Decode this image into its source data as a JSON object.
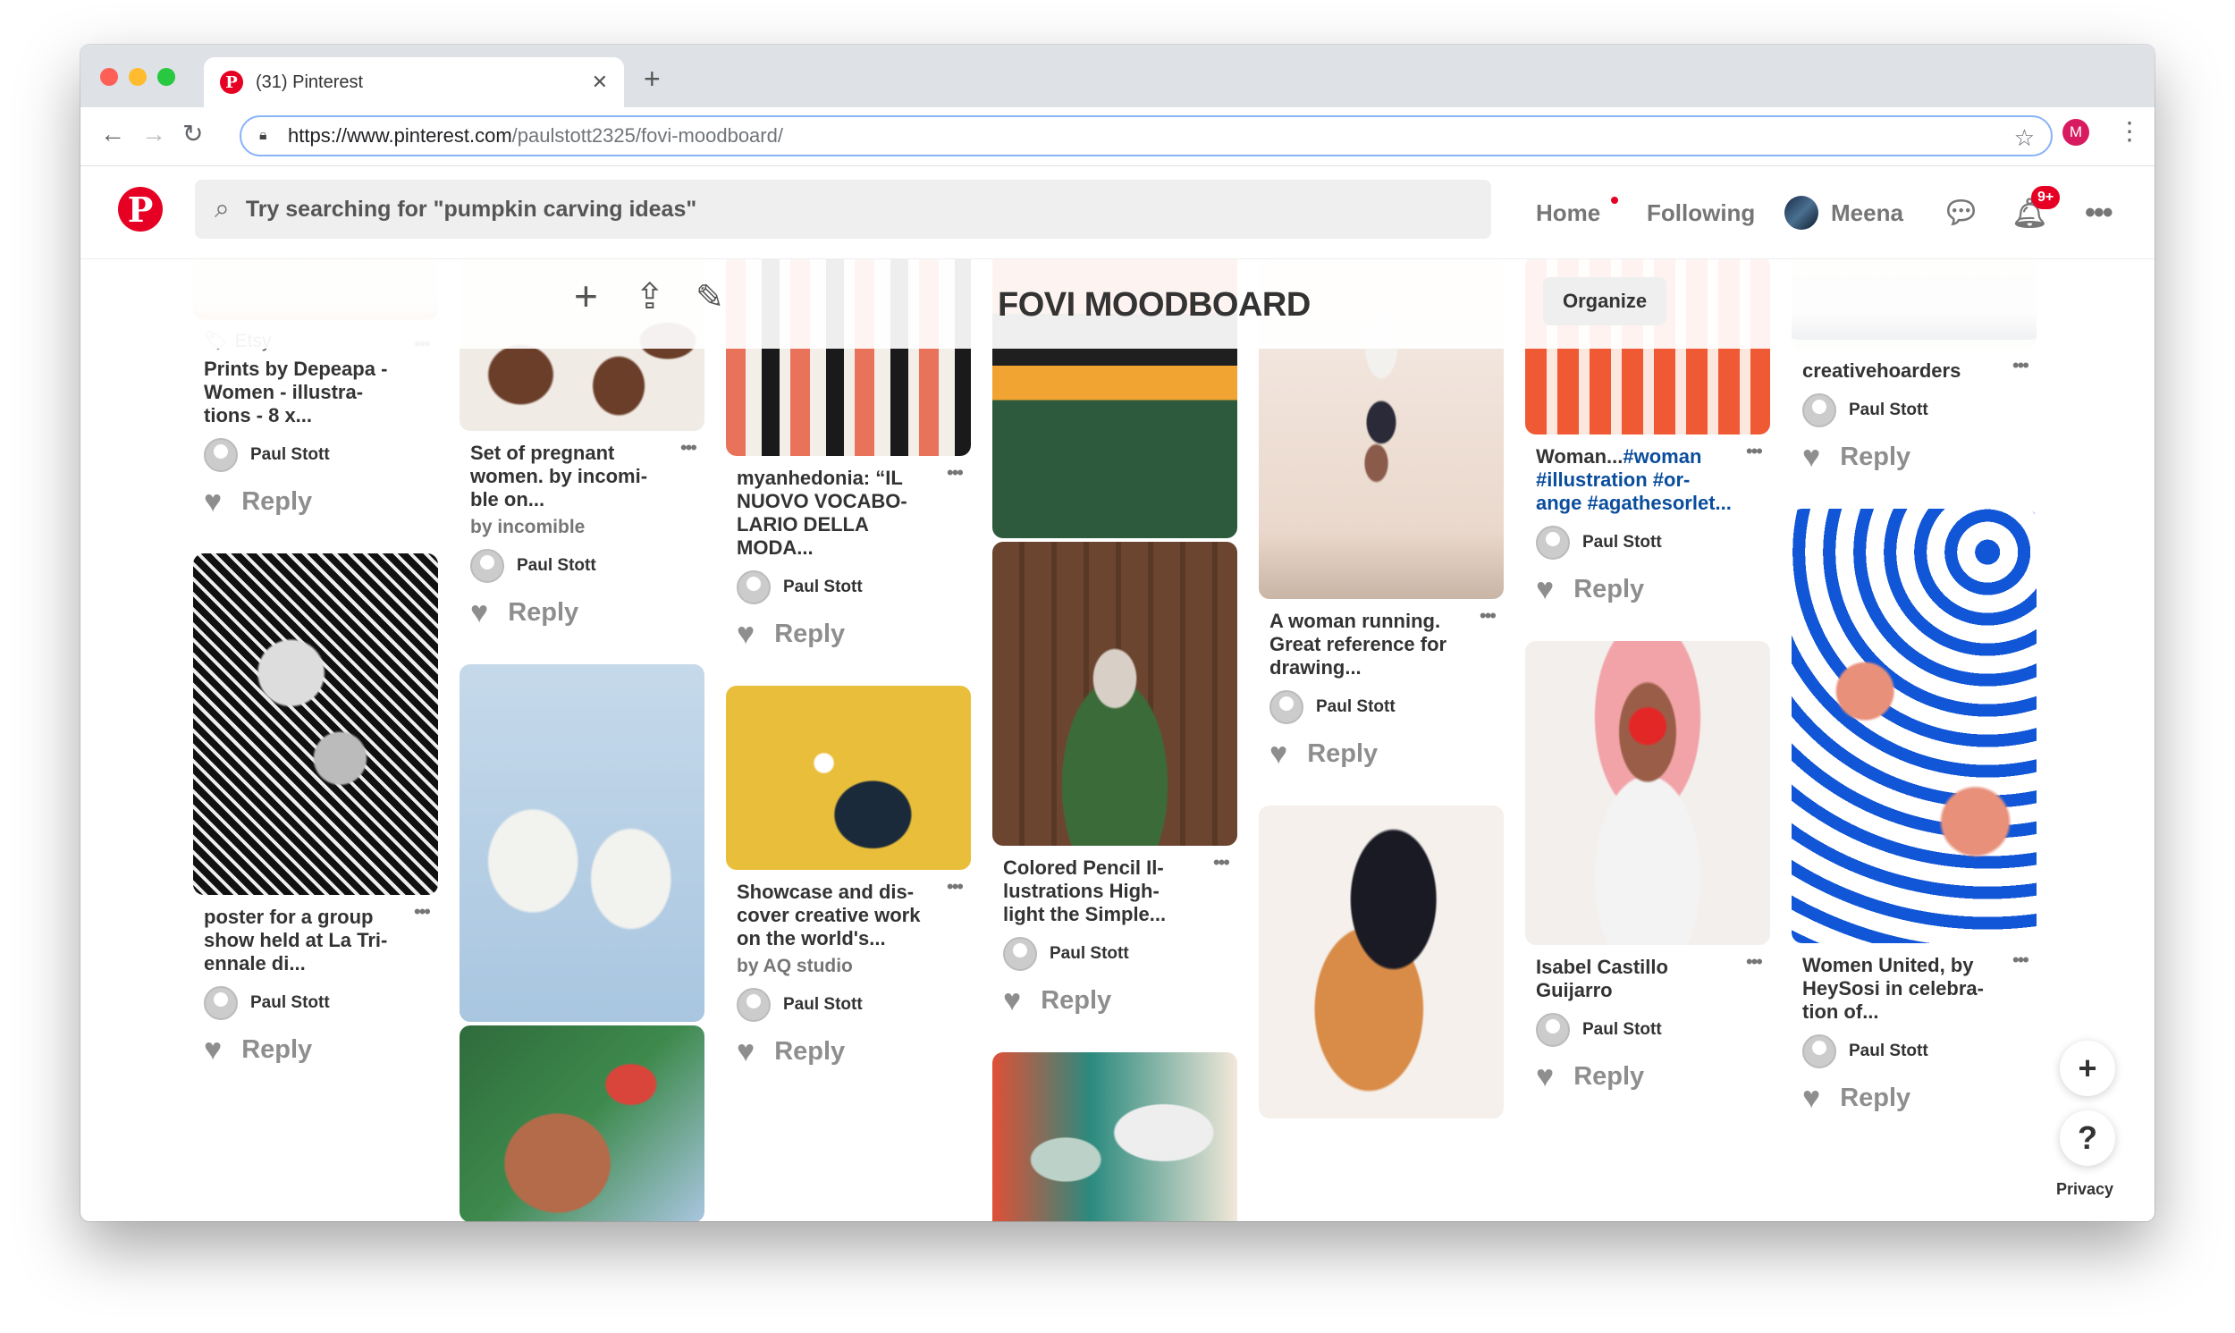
{
  "browser": {
    "tab_title": "(31) Pinterest",
    "url_main": "https://www.pinterest.com",
    "url_path": "/paulstott2325/fovi-moodboard/",
    "profile_initial": "M"
  },
  "header": {
    "logo": "P",
    "search_placeholder": "Try searching for \"pumpkin carving ideas\"",
    "nav": {
      "home": "Home",
      "following": "Following",
      "user": "Meena"
    },
    "notification_badge": "9+"
  },
  "board": {
    "title": "FOVI MOODBOARD",
    "organize_label": "Organize"
  },
  "common": {
    "reply": "Reply",
    "user": "Paul Stott"
  },
  "pins": {
    "c1a": {
      "source": "Etsy",
      "title": "Prints by Depeapa - Women - illustra-tions - 8 x..."
    },
    "c1b": {
      "title": "poster for a group show held at La Tri-ennale di..."
    },
    "c2a": {
      "title": "Set of pregnant women. by incomi-ble on...",
      "by": "by incomible"
    },
    "c3a": {
      "title": "myanhedonia: “IL NUOVO VOCABO-LARIO DELLA MODA..."
    },
    "c3b": {
      "title": "Showcase and dis-cover creative work on the world's...",
      "by": "by AQ studio"
    },
    "c4a": {
      "title": "Colored Pencil Il-lustrations High-light the Simple..."
    },
    "c5a": {
      "title": "A woman running. Great reference for drawing..."
    },
    "c6a": {
      "title": "Woman...#woman #illustration #or-ange #agathesorlet..."
    },
    "c6b": {
      "title": "Isabel Castillo Guijarro"
    },
    "c7a": {
      "title": "creativehoarders"
    },
    "c7b": {
      "title": "Women United, by HeySosi in celebra-tion of..."
    }
  },
  "fab": {
    "add": "+",
    "help": "?",
    "privacy": "Privacy"
  },
  "colors": {
    "brand": "#e60023",
    "omnibox_border": "#8ab4f8"
  }
}
